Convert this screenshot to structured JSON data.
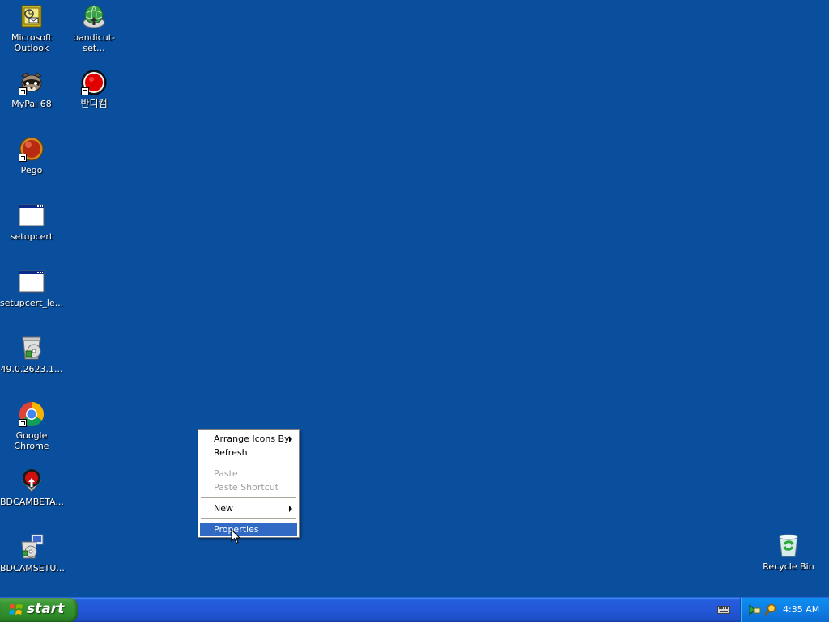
{
  "desktop": {
    "background_color": "#0a4f9e",
    "icons": [
      {
        "label": "Microsoft\nOutlook",
        "icon": "outlook-icon",
        "shortcut": false
      },
      {
        "label": "bandicut-set...",
        "icon": "installer-globe-icon",
        "shortcut": false
      },
      {
        "label": "MyPal 68",
        "icon": "raccoon-icon",
        "shortcut": true
      },
      {
        "label": "반디캠",
        "icon": "bandicam-record-icon",
        "shortcut": true
      },
      {
        "label": "Pego",
        "icon": "pego-orb-icon",
        "shortcut": true
      },
      {
        "label": "setupcert",
        "icon": "application-window-icon",
        "shortcut": false
      },
      {
        "label": "setupcert_le...",
        "icon": "application-window-icon",
        "shortcut": false
      },
      {
        "label": "49.0.2623.1...",
        "icon": "setup-package-icon",
        "shortcut": false
      },
      {
        "label": "Google Chrome",
        "icon": "chrome-icon",
        "shortcut": true
      },
      {
        "label": "BDCAMBETA...",
        "icon": "bandicam-installer-icon",
        "shortcut": false
      },
      {
        "label": "BDCAMSETU...",
        "icon": "setup-package-icon",
        "shortcut": false
      },
      {
        "label": "Recycle Bin",
        "icon": "recycle-bin-icon",
        "shortcut": false
      }
    ]
  },
  "context_menu": {
    "items": [
      {
        "label": "Arrange Icons By",
        "submenu": true,
        "disabled": false
      },
      {
        "label": "Refresh",
        "submenu": false,
        "disabled": false
      },
      {
        "label": "Paste",
        "submenu": false,
        "disabled": true
      },
      {
        "label": "Paste Shortcut",
        "submenu": false,
        "disabled": true
      },
      {
        "label": "New",
        "submenu": true,
        "disabled": false
      },
      {
        "label": "Properties",
        "submenu": false,
        "disabled": false,
        "selected": true
      }
    ]
  },
  "taskbar": {
    "start_label": "start",
    "clock": "4:35 AM",
    "tray_icons": [
      "network-icon",
      "search-icon"
    ],
    "keyboard_icon": "keyboard-icon"
  }
}
